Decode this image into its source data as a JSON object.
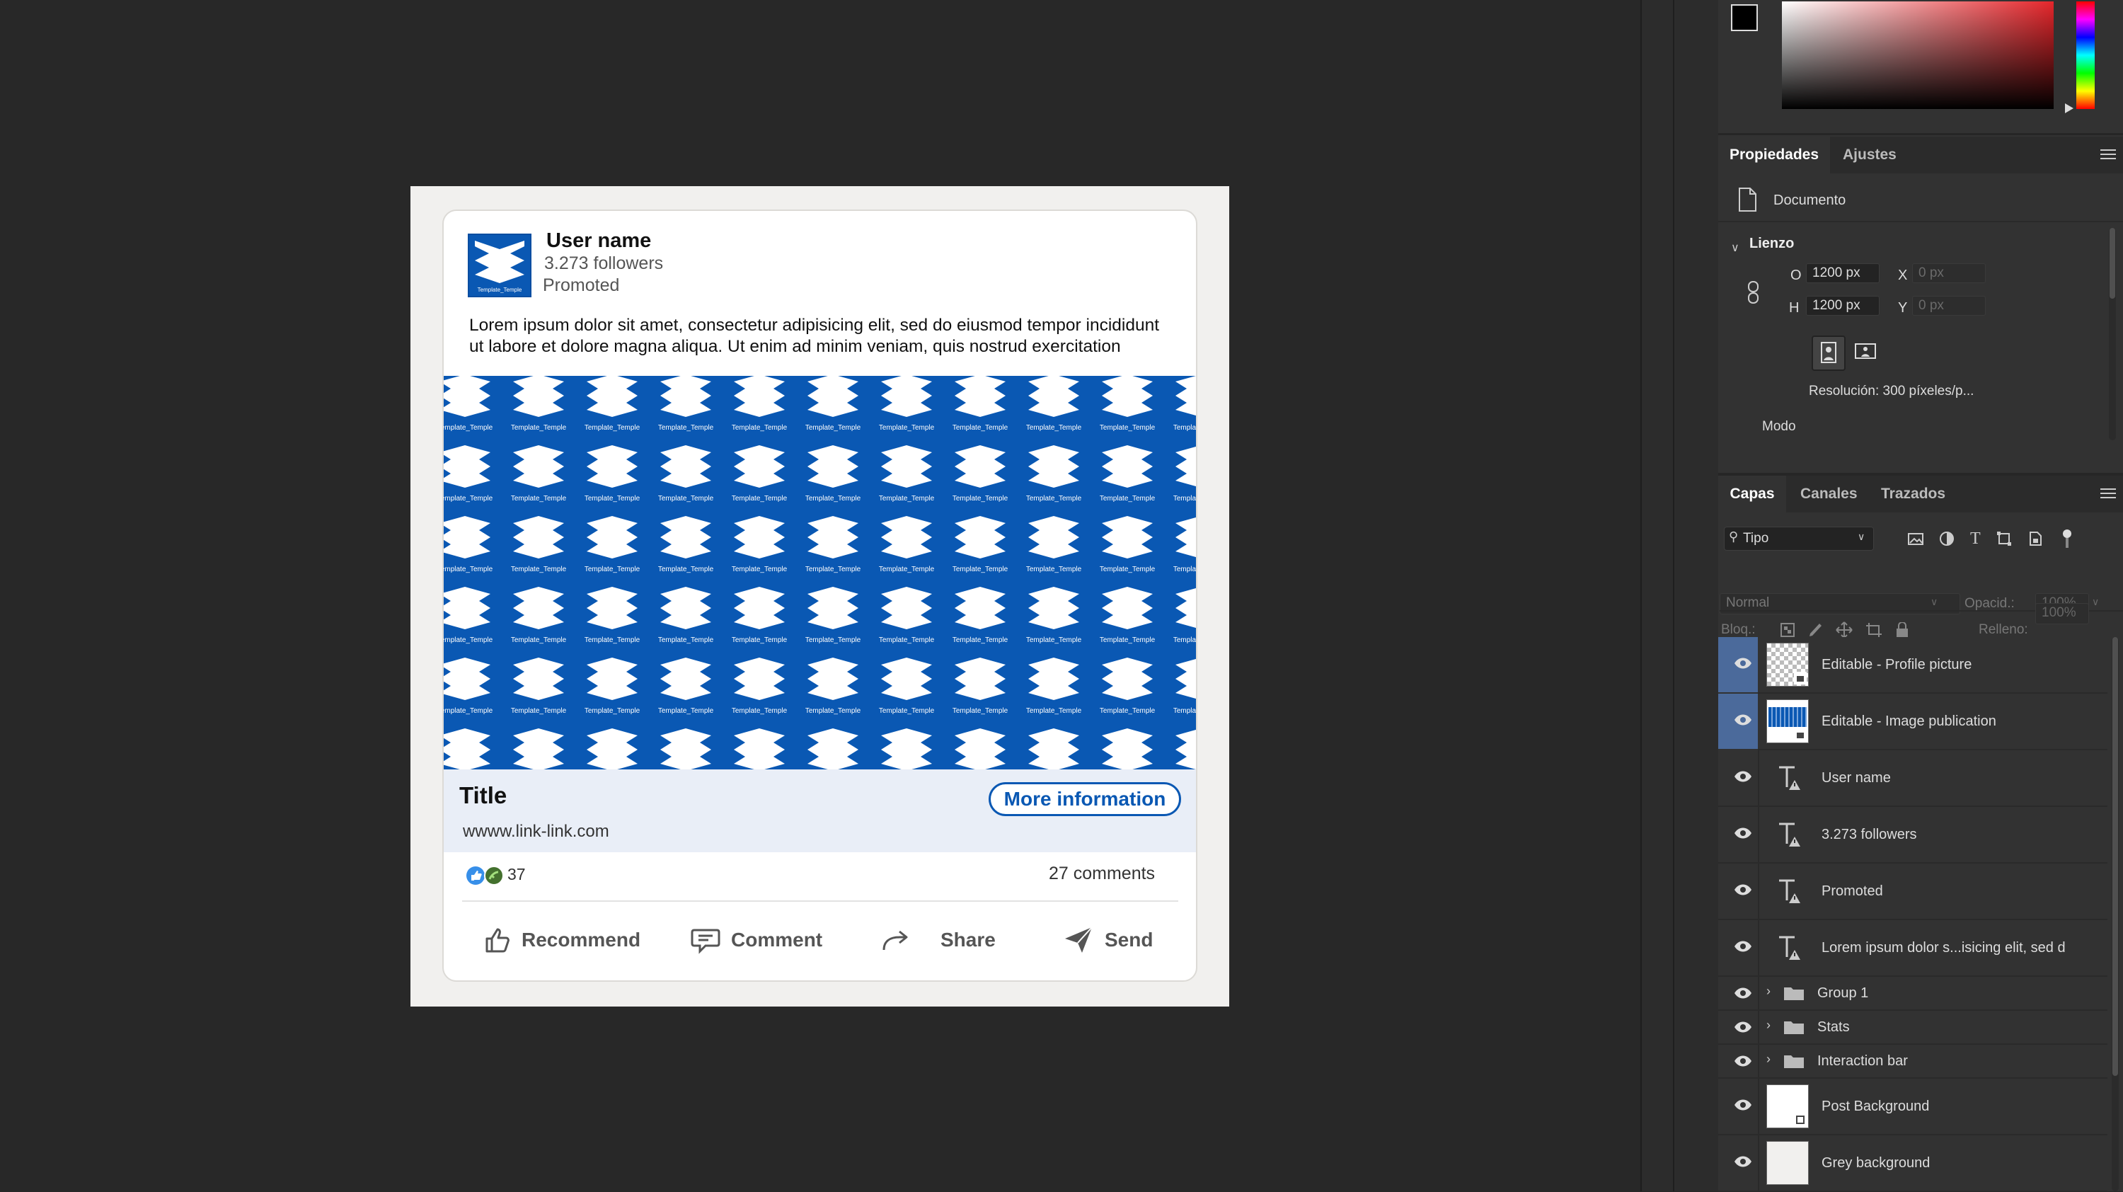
{
  "post": {
    "user_name": "User name",
    "followers": "3.273 followers",
    "promoted": "Promoted",
    "body": "Lorem ipsum dolor sit amet, consectetur adipisicing elit, sed do eiusmod tempor incididunt ut labore et dolore magna aliqua. Ut enim ad minim veniam, quis nostrud exercitation",
    "image_tile_text": "Template_Temple",
    "link_title": "Title",
    "link_url": "wwww.link-link.com",
    "more_button": "More information",
    "reactions_count": "37",
    "comments_count": "27 comments",
    "actions": {
      "recommend": "Recommend",
      "comment": "Comment",
      "share": "Share",
      "send": "Send"
    },
    "brand_color": "#0a58b3"
  },
  "properties_panel": {
    "tabs": [
      "Propiedades",
      "Ajustes"
    ],
    "document_label": "Documento",
    "canvas_section": "Lienzo",
    "width_label": "O",
    "width_value": "1200 px",
    "height_label": "H",
    "height_value": "1200 px",
    "x_label": "X",
    "x_value": "0 px",
    "y_label": "Y",
    "y_value": "0 px",
    "resolution": "Resolución: 300 píxeles/p...",
    "mode_label": "Modo"
  },
  "layers_panel": {
    "tabs": [
      "Capas",
      "Canales",
      "Trazados"
    ],
    "filter_label": "Tipo",
    "blend_mode": "Normal",
    "opacity_label": "Opacid.:",
    "opacity_value": "100%",
    "lock_label": "Bloq.:",
    "fill_label": "Relleno:",
    "fill_value": "100%",
    "layers": [
      {
        "name": "Editable - Profile picture",
        "kind": "smart",
        "selected": true
      },
      {
        "name": "Editable - Image publication",
        "kind": "smart",
        "selected": true
      },
      {
        "name": "User name",
        "kind": "text"
      },
      {
        "name": "3.273 followers",
        "kind": "text"
      },
      {
        "name": "Promoted",
        "kind": "text"
      },
      {
        "name": "Lorem ipsum dolor s...isicing elit, sed d",
        "kind": "text"
      },
      {
        "name": "Group 1",
        "kind": "group"
      },
      {
        "name": "Stats",
        "kind": "group"
      },
      {
        "name": "Interaction bar",
        "kind": "group"
      },
      {
        "name": "Post Background",
        "kind": "shape"
      },
      {
        "name": "Grey background",
        "kind": "fill"
      }
    ]
  },
  "colors": {
    "selected_layer_bg": "#4b6a9b",
    "panel_bg": "#323232",
    "canvas_bg": "#282828"
  }
}
